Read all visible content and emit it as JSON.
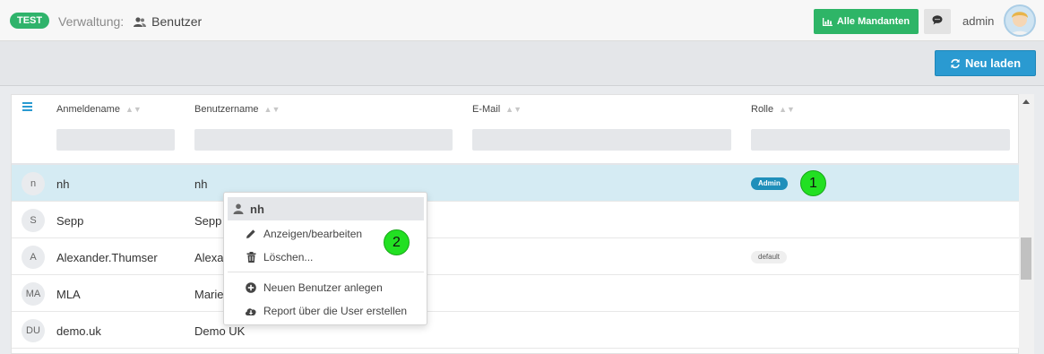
{
  "header": {
    "env_badge": "TEST",
    "section": "Verwaltung:",
    "page": "Benutzer",
    "mandanten_button": "Alle Mandanten",
    "user": "admin"
  },
  "toolbar": {
    "reload_label": "Neu laden"
  },
  "table": {
    "columns": [
      "Anmeldename",
      "Benutzername",
      "E-Mail",
      "Rolle"
    ],
    "rows": [
      {
        "initials": "n",
        "login": "nh",
        "name": "nh",
        "role": "Admin"
      },
      {
        "initials": "S",
        "login": "Sepp",
        "name": "Sepp",
        "role": ""
      },
      {
        "initials": "A",
        "login": "Alexander.Thumser",
        "name": "Alexa",
        "role": "default"
      },
      {
        "initials": "MA",
        "login": "MLA",
        "name": "Marie",
        "role": ""
      },
      {
        "initials": "DU",
        "login": "demo.uk",
        "name": "Demo UK",
        "role": ""
      }
    ]
  },
  "context_menu": {
    "title": "nh",
    "items": [
      {
        "label": "Anzeigen/bearbeiten",
        "icon": "pencil-icon"
      },
      {
        "label": "Löschen...",
        "icon": "trash-icon"
      },
      {
        "label": "Neuen Benutzer anlegen",
        "icon": "plus-circle-icon"
      },
      {
        "label": "Report über die User erstellen",
        "icon": "cloud-download-icon"
      }
    ]
  },
  "markers": [
    "1",
    "2"
  ],
  "colors": {
    "accent_green": "#2eb567",
    "accent_blue": "#2a9ad1",
    "selected_row": "#d5ebf3",
    "marker": "#22e022"
  }
}
